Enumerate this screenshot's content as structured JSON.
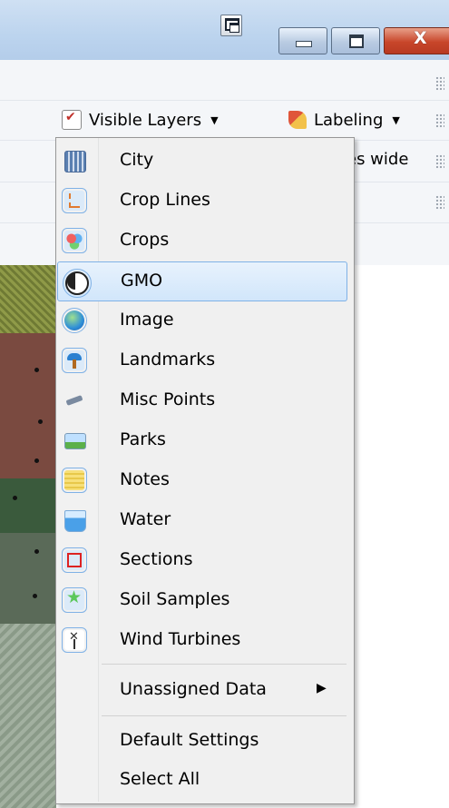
{
  "toolbar": {
    "visible_layers_label": "Visible Layers",
    "labeling_label": "Labeling",
    "partial_text": "es wide"
  },
  "menu": {
    "layers": [
      {
        "label": "City",
        "icon": "city-icon"
      },
      {
        "label": "Crop Lines",
        "icon": "crop-lines-icon"
      },
      {
        "label": "Crops",
        "icon": "crops-icon"
      },
      {
        "label": "GMO",
        "icon": "gmo-icon"
      },
      {
        "label": "Image",
        "icon": "image-icon"
      },
      {
        "label": "Landmarks",
        "icon": "landmarks-icon"
      },
      {
        "label": "Misc Points",
        "icon": "misc-points-icon"
      },
      {
        "label": "Parks",
        "icon": "parks-icon"
      },
      {
        "label": "Notes",
        "icon": "notes-icon"
      },
      {
        "label": "Water",
        "icon": "water-icon"
      },
      {
        "label": "Sections",
        "icon": "sections-icon"
      },
      {
        "label": "Soil Samples",
        "icon": "soil-samples-icon"
      },
      {
        "label": "Wind Turbines",
        "icon": "wind-turbines-icon"
      }
    ],
    "unassigned_label": "Unassigned Data",
    "default_settings_label": "Default Settings",
    "select_all_label": "Select All",
    "selected_item": "GMO"
  },
  "colors": {
    "titlebar": "#bcd4ee",
    "selection_border": "#7fb1e6",
    "close_button": "#c8462a"
  }
}
